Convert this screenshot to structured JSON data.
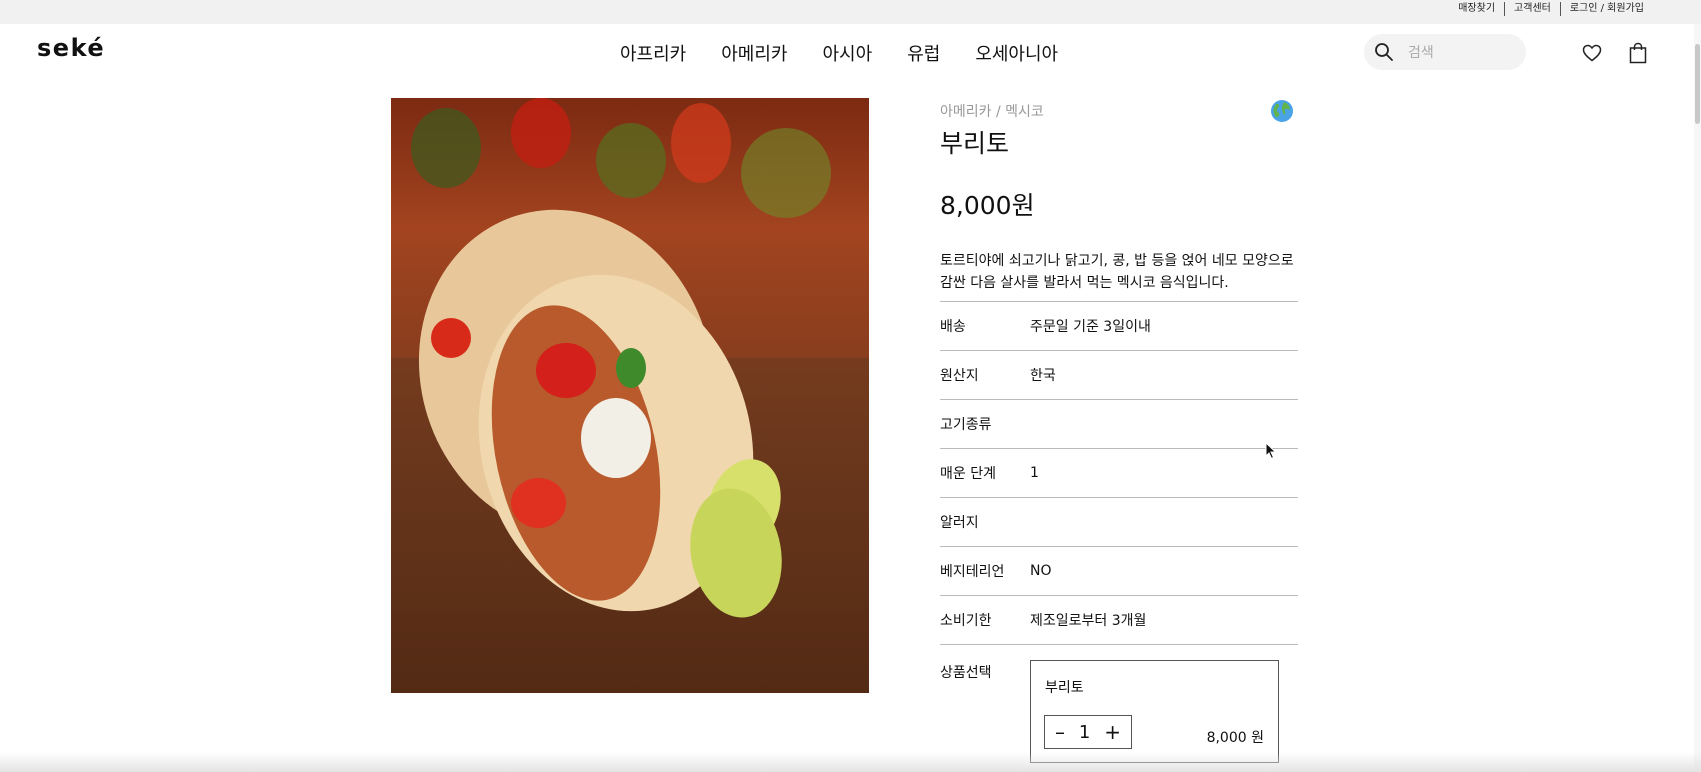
{
  "top_links": {
    "store_finder": "매장찾기",
    "customer_center": "고객센터",
    "login_signup": "로그인 / 회원가입"
  },
  "header": {
    "logo": "seké",
    "nav": [
      "아프리카",
      "아메리카",
      "아시아",
      "유럽",
      "오세아니아"
    ],
    "search_placeholder": "검색",
    "icons": [
      "search-icon",
      "heart-icon",
      "shopping-bag-icon"
    ]
  },
  "product": {
    "breadcrumb": "아메리카 / 멕시코",
    "name": "부리토",
    "price": "8,000원",
    "description": "토르티야에 쇠고기나 닭고기, 콩, 밥 등을 얹어 네모 모양으로 감싼 다음 살사를 발라서 먹는 멕시코 음식입니다.",
    "specs": [
      {
        "label": "배송",
        "value": "주문일 기준 3일이내"
      },
      {
        "label": "원산지",
        "value": "한국"
      },
      {
        "label": "고기종류",
        "value": ""
      },
      {
        "label": "매운 단계",
        "value": "1"
      },
      {
        "label": "알러지",
        "value": ""
      },
      {
        "label": "베지테리언",
        "value": "NO"
      },
      {
        "label": "소비기한",
        "value": "제조일로부터 3개월"
      }
    ],
    "option_label": "상품선택",
    "option": {
      "name": "부리토",
      "quantity": "1",
      "minus": "–",
      "plus": "+",
      "price": "8,000 원"
    }
  }
}
